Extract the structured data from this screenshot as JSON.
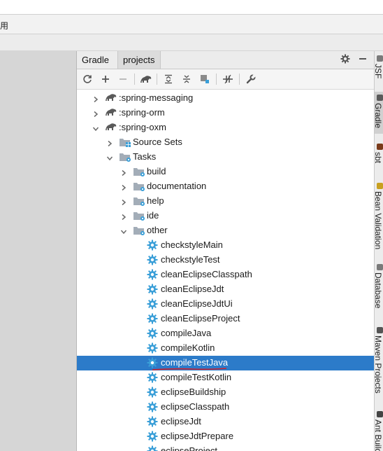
{
  "menubar": {
    "fragment": "用"
  },
  "tabs": [
    {
      "label": "Gradle"
    },
    {
      "label": "projects"
    }
  ],
  "tree": [
    {
      "label": ":spring-messaging",
      "depth": 0,
      "expanded": false,
      "type": "project"
    },
    {
      "label": ":spring-orm",
      "depth": 0,
      "expanded": false,
      "type": "project"
    },
    {
      "label": ":spring-oxm",
      "depth": 0,
      "expanded": true,
      "type": "project"
    },
    {
      "label": "Source Sets",
      "depth": 1,
      "expanded": false,
      "type": "sourcesets"
    },
    {
      "label": "Tasks",
      "depth": 1,
      "expanded": true,
      "type": "tasksfolder"
    },
    {
      "label": "build",
      "depth": 2,
      "expanded": false,
      "type": "folder"
    },
    {
      "label": "documentation",
      "depth": 2,
      "expanded": false,
      "type": "folder"
    },
    {
      "label": "help",
      "depth": 2,
      "expanded": false,
      "type": "folder"
    },
    {
      "label": "ide",
      "depth": 2,
      "expanded": false,
      "type": "folder"
    },
    {
      "label": "other",
      "depth": 2,
      "expanded": true,
      "type": "folder"
    },
    {
      "label": "checkstyleMain",
      "depth": 3,
      "type": "task"
    },
    {
      "label": "checkstyleTest",
      "depth": 3,
      "type": "task"
    },
    {
      "label": "cleanEclipseClasspath",
      "depth": 3,
      "type": "task"
    },
    {
      "label": "cleanEclipseJdt",
      "depth": 3,
      "type": "task"
    },
    {
      "label": "cleanEclipseJdtUi",
      "depth": 3,
      "type": "task"
    },
    {
      "label": "cleanEclipseProject",
      "depth": 3,
      "type": "task"
    },
    {
      "label": "compileJava",
      "depth": 3,
      "type": "task"
    },
    {
      "label": "compileKotlin",
      "depth": 3,
      "type": "task"
    },
    {
      "label": "compileTestJava",
      "depth": 3,
      "type": "task",
      "selected": true
    },
    {
      "label": "compileTestKotlin",
      "depth": 3,
      "type": "task"
    },
    {
      "label": "eclipseBuildship",
      "depth": 3,
      "type": "task"
    },
    {
      "label": "eclipseClasspath",
      "depth": 3,
      "type": "task"
    },
    {
      "label": "eclipseJdt",
      "depth": 3,
      "type": "task"
    },
    {
      "label": "eclipseJdtPrepare",
      "depth": 3,
      "type": "task"
    },
    {
      "label": "eclipseProject",
      "depth": 3,
      "type": "task"
    }
  ],
  "right_tabs": [
    {
      "label": "JSF",
      "icon": "jsf-icon"
    },
    {
      "label": "Gradle",
      "icon": "gradle-icon",
      "active": true
    },
    {
      "label": "sbt",
      "icon": "sbt-icon"
    },
    {
      "label": "Bean Validation",
      "icon": "bean-validation-icon"
    },
    {
      "label": "Database",
      "icon": "database-icon"
    },
    {
      "label": "Maven Projects",
      "icon": "maven-icon"
    },
    {
      "label": "Ant Build",
      "icon": "ant-icon"
    }
  ],
  "colors": {
    "selection": "#2c7bc9",
    "task_gear": "#3a9fd8",
    "folder": "#9aa7b3",
    "annotation_underline": "#d0202a"
  }
}
